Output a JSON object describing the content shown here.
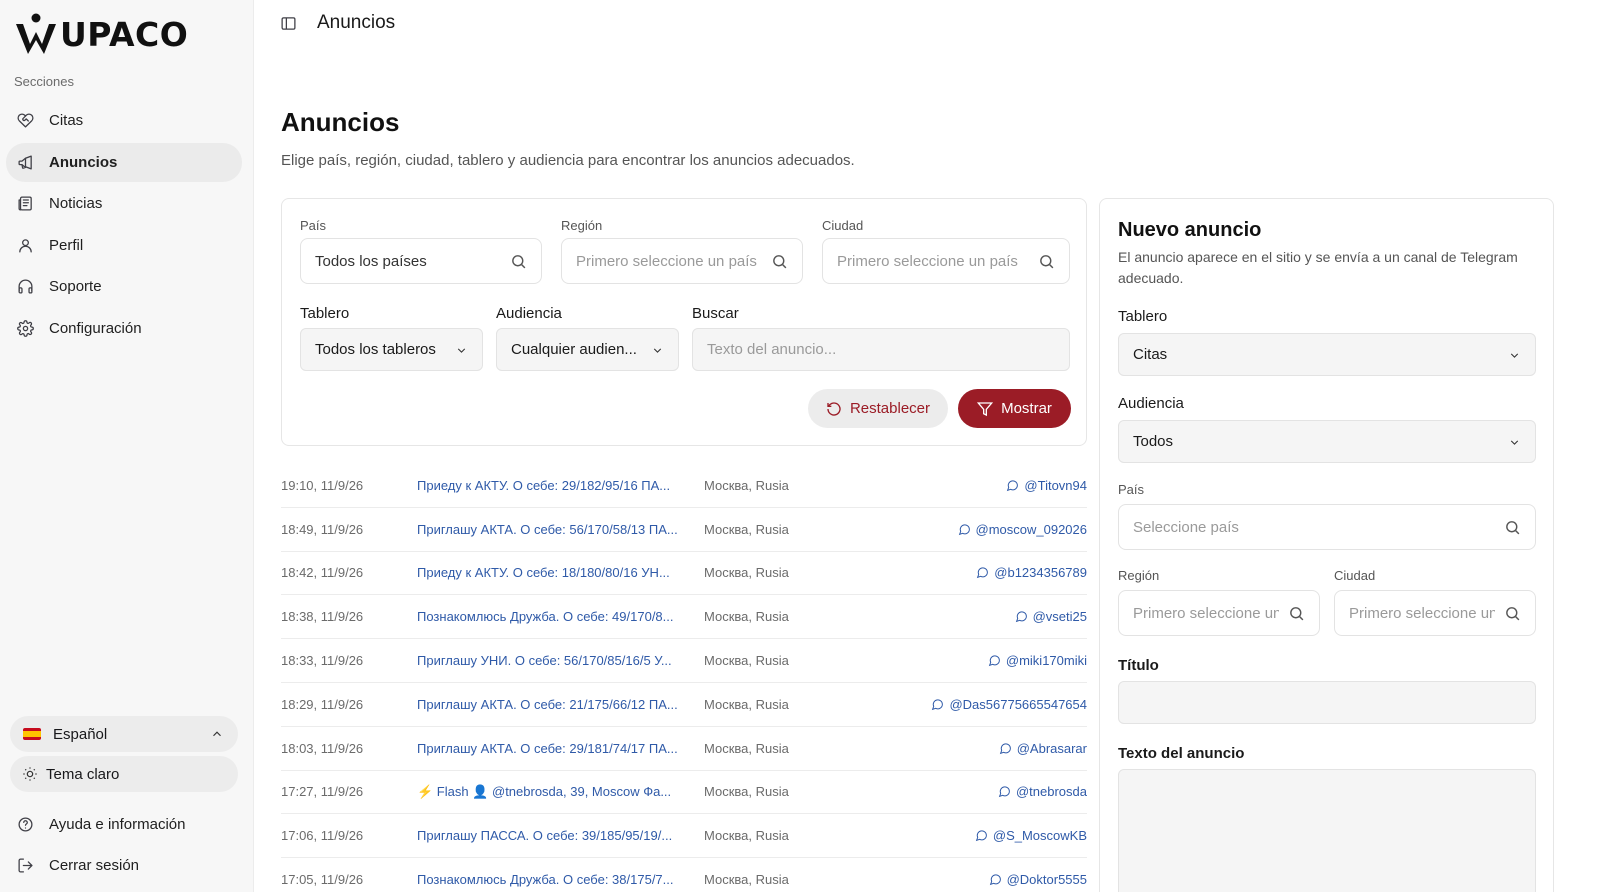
{
  "brand": {
    "name": "UPACO"
  },
  "sidebar": {
    "section_label": "Secciones",
    "items": [
      {
        "label": "Citas",
        "icon": "heart-handshake-icon"
      },
      {
        "label": "Anuncios",
        "icon": "megaphone-icon",
        "active": true
      },
      {
        "label": "Noticias",
        "icon": "newspaper-icon"
      },
      {
        "label": "Perfil",
        "icon": "user-icon"
      },
      {
        "label": "Soporte",
        "icon": "headphones-icon"
      },
      {
        "label": "Configuración",
        "icon": "gear-icon"
      }
    ],
    "language": "Español",
    "theme": "Tema claro",
    "help": "Ayuda e información",
    "logout": "Cerrar sesión"
  },
  "topbar": {
    "title": "Anuncios"
  },
  "page": {
    "title": "Anuncios",
    "subtitle": "Elige país, región, ciudad, tablero y audiencia para encontrar los anuncios adecuados."
  },
  "filters": {
    "country_label": "País",
    "country_value": "Todos los países",
    "region_label": "Región",
    "region_placeholder": "Primero seleccione un país",
    "city_label": "Ciudad",
    "city_placeholder": "Primero seleccione un país",
    "board_label": "Tablero",
    "board_value": "Todos los tableros",
    "audience_label": "Audiencia",
    "audience_value": "Cualquier audien...",
    "search_label": "Buscar",
    "search_placeholder": "Texto del anuncio...",
    "reset_label": "Restablecer",
    "show_label": "Mostrar"
  },
  "ads": [
    {
      "time": "19:10, 11/9/26",
      "title": "Приеду к АКТУ. О себе: 29/182/95/16 ПА...",
      "location": "Москва, Rusia",
      "user": "@Titovn94"
    },
    {
      "time": "18:49, 11/9/26",
      "title": "Приглашу АКТА. О себе: 56/170/58/13 ПА...",
      "location": "Москва, Rusia",
      "user": "@moscow_092026"
    },
    {
      "time": "18:42, 11/9/26",
      "title": "Приеду к АКТУ. О себе: 18/180/80/16 УН...",
      "location": "Москва, Rusia",
      "user": "@b1234356789"
    },
    {
      "time": "18:38, 11/9/26",
      "title": "Познакомлюсь Дружба. О себе: 49/170/8...",
      "location": "Москва, Rusia",
      "user": "@vseti25"
    },
    {
      "time": "18:33, 11/9/26",
      "title": "Приглашу УНИ. О себе: 56/170/85/16/5 У...",
      "location": "Москва, Rusia",
      "user": "@miki170miki"
    },
    {
      "time": "18:29, 11/9/26",
      "title": "Приглашу АКТА. О себе: 21/175/66/12 ПА...",
      "location": "Москва, Rusia",
      "user": "@Das56775665547654"
    },
    {
      "time": "18:03, 11/9/26",
      "title": "Приглашу АКТА. О себе: 29/181/74/17 ПА...",
      "location": "Москва, Rusia",
      "user": "@Abrasarar"
    },
    {
      "time": "17:27, 11/9/26",
      "title": "⚡ Flash 👤 @tnebrosda, 39, Moscow Фа...",
      "location": "Москва, Rusia",
      "user": "@tnebrosda"
    },
    {
      "time": "17:06, 11/9/26",
      "title": "Приглашу ПАССА. О себе: 39/185/95/19/...",
      "location": "Москва, Rusia",
      "user": "@S_MoscowKB"
    },
    {
      "time": "17:05, 11/9/26",
      "title": "Познакомлюсь Дружба. О себе: 38/175/7...",
      "location": "Москва, Rusia",
      "user": "@Doktor5555"
    }
  ],
  "new_ad": {
    "title": "Nuevo anuncio",
    "subtitle": "El anuncio aparece en el sitio y se envía a un canal de Telegram adecuado.",
    "board_label": "Tablero",
    "board_value": "Citas",
    "audience_label": "Audiencia",
    "audience_value": "Todos",
    "country_label": "País",
    "country_placeholder": "Seleccione país",
    "region_label": "Región",
    "region_placeholder": "Primero seleccione un país",
    "city_label": "Ciudad",
    "city_placeholder": "Primero seleccione un país",
    "title_label": "Título",
    "text_label": "Texto del anuncio"
  },
  "colors": {
    "accent": "#9b1c26",
    "link": "#2f5aa8",
    "sidebar_bg": "#f7f7f7"
  }
}
